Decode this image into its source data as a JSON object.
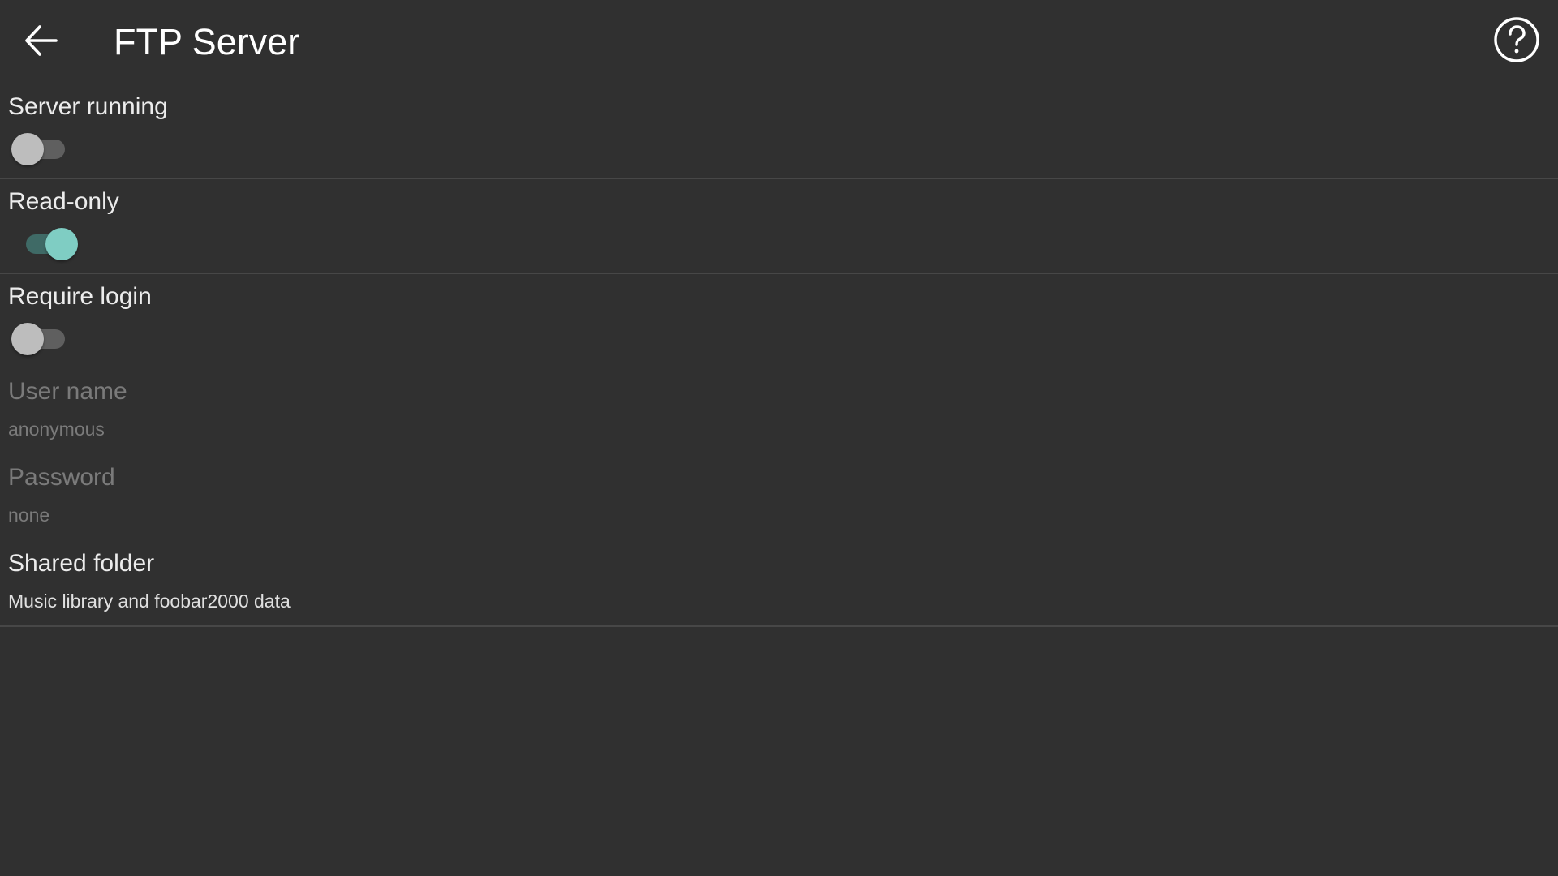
{
  "header": {
    "title": "FTP Server",
    "back_icon": "arrow-back-icon",
    "help_icon": "help-circle-icon"
  },
  "colors": {
    "background": "#303030",
    "accent": "#7fcdc3",
    "divider": "#474747",
    "disabled_text": "#7a7a7a"
  },
  "preferences": {
    "server_running": {
      "label": "Server running",
      "checked": false
    },
    "read_only": {
      "label": "Read-only",
      "checked": true
    },
    "require_login": {
      "label": "Require login",
      "checked": false
    },
    "user_name": {
      "label": "User name",
      "summary": "anonymous",
      "enabled": false
    },
    "password": {
      "label": "Password",
      "summary": "none",
      "enabled": false
    },
    "shared_folder": {
      "label": "Shared folder",
      "summary": "Music library and foobar2000 data"
    }
  }
}
